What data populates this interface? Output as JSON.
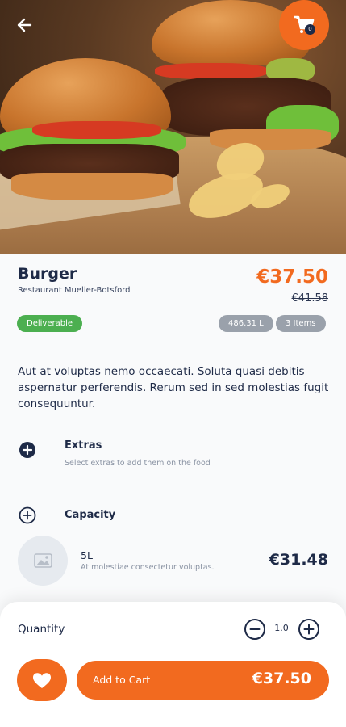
{
  "hero": {
    "image_alt": "Burger photo",
    "back_icon": "arrow-left-icon",
    "cart_icon": "shopping-cart-icon",
    "cart_count": "0"
  },
  "product": {
    "name": "Burger",
    "restaurant": "Restaurant Mueller-Botsford",
    "price": "€37.50",
    "old_price": "€41.58",
    "badge_status": "Deliverable",
    "badge_weight": "486.31 L",
    "badge_items": "3 Items",
    "description": "Aut at voluptas nemo occaecati. Soluta quasi debitis aspernatur perferendis. Rerum sed in sed molestias fugit consequuntur."
  },
  "extras": {
    "title": "Extras",
    "subtitle": "Select extras to add them on the food",
    "icon": "plus-circle-filled-icon"
  },
  "capacity": {
    "title": "Capacity",
    "icon": "plus-circle-outline-icon",
    "option": {
      "name": "5L",
      "description": "At molestiae consectetur voluptas.",
      "price": "€31.48",
      "thumb_icon": "image-placeholder-icon"
    }
  },
  "cart": {
    "quantity_label": "Quantity",
    "quantity_value": "1.0",
    "add_label": "Add to Cart",
    "total": "€37.50",
    "fav_icon": "heart-icon"
  },
  "colors": {
    "accent": "#f26a1f",
    "navy": "#1e2a47",
    "green": "#4caf50",
    "grey_badge": "#9aa1ab"
  }
}
